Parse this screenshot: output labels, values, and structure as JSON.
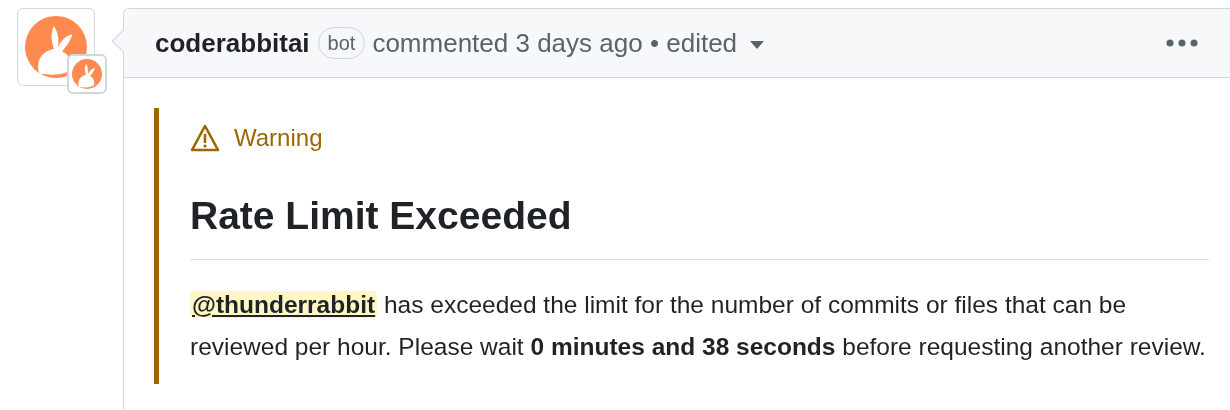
{
  "comment": {
    "author": "coderabbitai",
    "badge": "bot",
    "action": "commented 3 days ago • edited",
    "body": {
      "alert": {
        "kind": "warning",
        "label": "Warning"
      },
      "heading": "Rate Limit Exceeded",
      "mention": "@thunderrabbit",
      "text": "has exceeded the limit for the number of commits or files that can be reviewed per hour. Please wait **0 minutes and 38 seconds** before requesting another review."
    }
  }
}
